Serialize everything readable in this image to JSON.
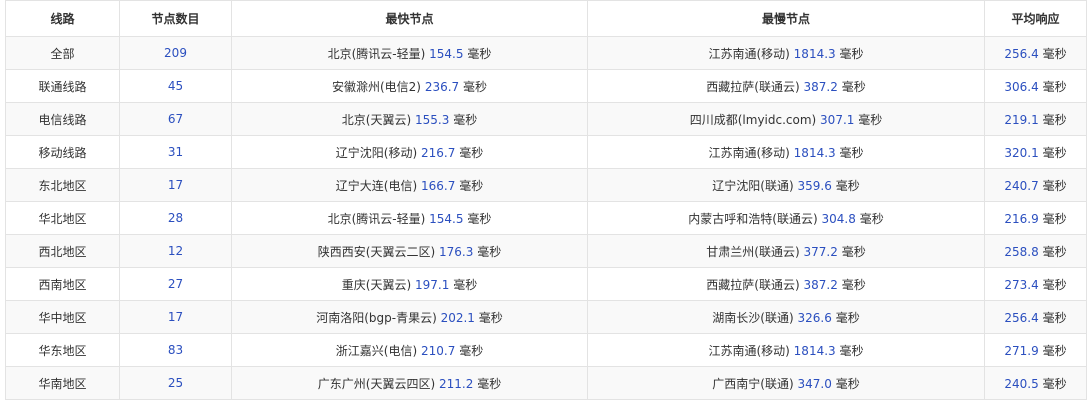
{
  "headers": [
    "线路",
    "节点数目",
    "最快节点",
    "最慢节点",
    "平均响应"
  ],
  "unit": "毫秒",
  "rows": [
    {
      "line": "全部",
      "count": "209",
      "fast_node": "北京(腾讯云-轻量)",
      "fast_ms": "154.5",
      "slow_node": "江苏南通(移动)",
      "slow_ms": "1814.3",
      "avg_ms": "256.4"
    },
    {
      "line": "联通线路",
      "count": "45",
      "fast_node": "安徽滁州(电信2)",
      "fast_ms": "236.7",
      "slow_node": "西藏拉萨(联通云)",
      "slow_ms": "387.2",
      "avg_ms": "306.4"
    },
    {
      "line": "电信线路",
      "count": "67",
      "fast_node": "北京(天翼云)",
      "fast_ms": "155.3",
      "slow_node": "四川成都(lmyidc.com)",
      "slow_ms": "307.1",
      "avg_ms": "219.1"
    },
    {
      "line": "移动线路",
      "count": "31",
      "fast_node": "辽宁沈阳(移动)",
      "fast_ms": "216.7",
      "slow_node": "江苏南通(移动)",
      "slow_ms": "1814.3",
      "avg_ms": "320.1"
    },
    {
      "line": "东北地区",
      "count": "17",
      "fast_node": "辽宁大连(电信)",
      "fast_ms": "166.7",
      "slow_node": "辽宁沈阳(联通)",
      "slow_ms": "359.6",
      "avg_ms": "240.7"
    },
    {
      "line": "华北地区",
      "count": "28",
      "fast_node": "北京(腾讯云-轻量)",
      "fast_ms": "154.5",
      "slow_node": "内蒙古呼和浩特(联通云)",
      "slow_ms": "304.8",
      "avg_ms": "216.9"
    },
    {
      "line": "西北地区",
      "count": "12",
      "fast_node": "陕西西安(天翼云二区)",
      "fast_ms": "176.3",
      "slow_node": "甘肃兰州(联通云)",
      "slow_ms": "377.2",
      "avg_ms": "258.8"
    },
    {
      "line": "西南地区",
      "count": "27",
      "fast_node": "重庆(天翼云)",
      "fast_ms": "197.1",
      "slow_node": "西藏拉萨(联通云)",
      "slow_ms": "387.2",
      "avg_ms": "273.4"
    },
    {
      "line": "华中地区",
      "count": "17",
      "fast_node": "河南洛阳(bgp-青果云)",
      "fast_ms": "202.1",
      "slow_node": "湖南长沙(联通)",
      "slow_ms": "326.6",
      "avg_ms": "256.4"
    },
    {
      "line": "华东地区",
      "count": "83",
      "fast_node": "浙江嘉兴(电信)",
      "fast_ms": "210.7",
      "slow_node": "江苏南通(移动)",
      "slow_ms": "1814.3",
      "avg_ms": "271.9"
    },
    {
      "line": "华南地区",
      "count": "25",
      "fast_node": "广东广州(天翼云四区)",
      "fast_ms": "211.2",
      "slow_node": "广西南宁(联通)",
      "slow_ms": "347.0",
      "avg_ms": "240.5"
    }
  ],
  "colors": {
    "number": "#2b4fbf",
    "text": "#333333",
    "border": "#e3e3e3",
    "stripe": "#f9f9f9"
  }
}
